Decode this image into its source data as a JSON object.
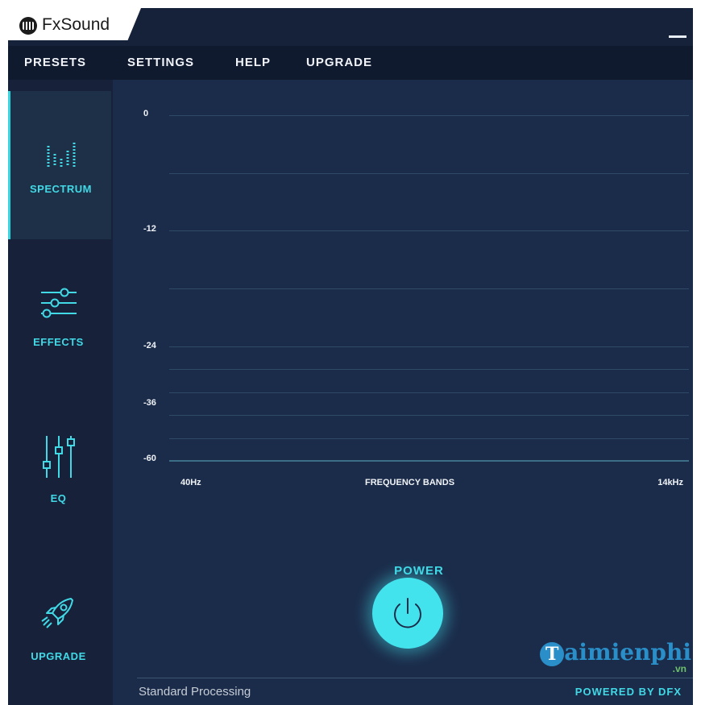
{
  "app": {
    "name": "FxSound"
  },
  "menu": {
    "presets": "PRESETS",
    "settings": "SETTINGS",
    "help": "HELP",
    "upgrade": "UPGRADE"
  },
  "sidebar": {
    "items": [
      {
        "label": "SPECTRUM",
        "icon": "spectrum-icon",
        "active": true
      },
      {
        "label": "EFFECTS",
        "icon": "sliders-icon",
        "active": false
      },
      {
        "label": "EQ",
        "icon": "eq-icon",
        "active": false
      },
      {
        "label": "UPGRADE",
        "icon": "rocket-icon",
        "active": false
      }
    ]
  },
  "spectrum": {
    "y_labels": [
      "0",
      "-12",
      "-24",
      "-36",
      "-60"
    ],
    "x_label_left": "40Hz",
    "x_label_center": "FREQUENCY BANDS",
    "x_label_right": "14kHz"
  },
  "power": {
    "label": "POWER",
    "icon": "power-icon"
  },
  "footer": {
    "status": "Standard Processing",
    "powered_by": "POWERED BY DFX"
  },
  "watermark": {
    "text": "aimienphi",
    "initial": "T",
    "suffix": ".vn"
  },
  "colors": {
    "accent": "#41d9e6",
    "background": "#1b2c4a",
    "sidebar": "#17223a",
    "menubar": "#101a2f"
  }
}
